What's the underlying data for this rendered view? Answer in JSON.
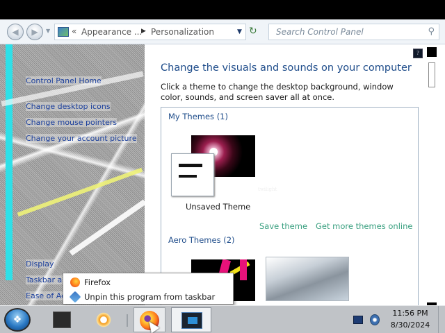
{
  "address_bar": {
    "back_glyph": "◀",
    "forward_glyph": "▶",
    "recent_glyph": "▼",
    "crumb_sep": "«",
    "crumb_appearance": "Appearance ...",
    "crumb_arrow": "▶",
    "crumb_personalization": "Personalization",
    "dropdown_glyph": "▼",
    "refresh_glyph": "↻",
    "search_placeholder": "Search Control Panel",
    "search_glyph": "⚲"
  },
  "nav": {
    "home": "Control Panel Home",
    "links": [
      "Change desktop icons",
      "Change mouse pointers",
      "Change your account picture"
    ],
    "see_also": [
      "Display",
      "Taskbar and Start Menu",
      "Ease of Ac"
    ]
  },
  "content": {
    "heading": "Change the visuals and sounds on your computer",
    "description": "Click a theme to change the desktop background, window color, sounds, and screen saver all at once.",
    "my_themes_title": "My Themes (1)",
    "theme_thumb_caption": "twilight",
    "unsaved_theme_label": "Unsaved Theme",
    "save_theme": "Save theme",
    "more_themes": "Get more themes online",
    "aero_themes_title": "Aero Themes (2)"
  },
  "help_glyph": "?",
  "jumplist": {
    "firefox": "Firefox",
    "unpin": "Unpin this program from taskbar"
  },
  "taskbar": {
    "start_glyph": "❖",
    "time": "11:56 PM",
    "date": "8/30/2024"
  },
  "colors": {
    "link_blue": "#1b3f9c",
    "heading_blue": "#1e4c8a",
    "action_green": "#3aa080",
    "nav_stripe": "#2ee0e8"
  }
}
